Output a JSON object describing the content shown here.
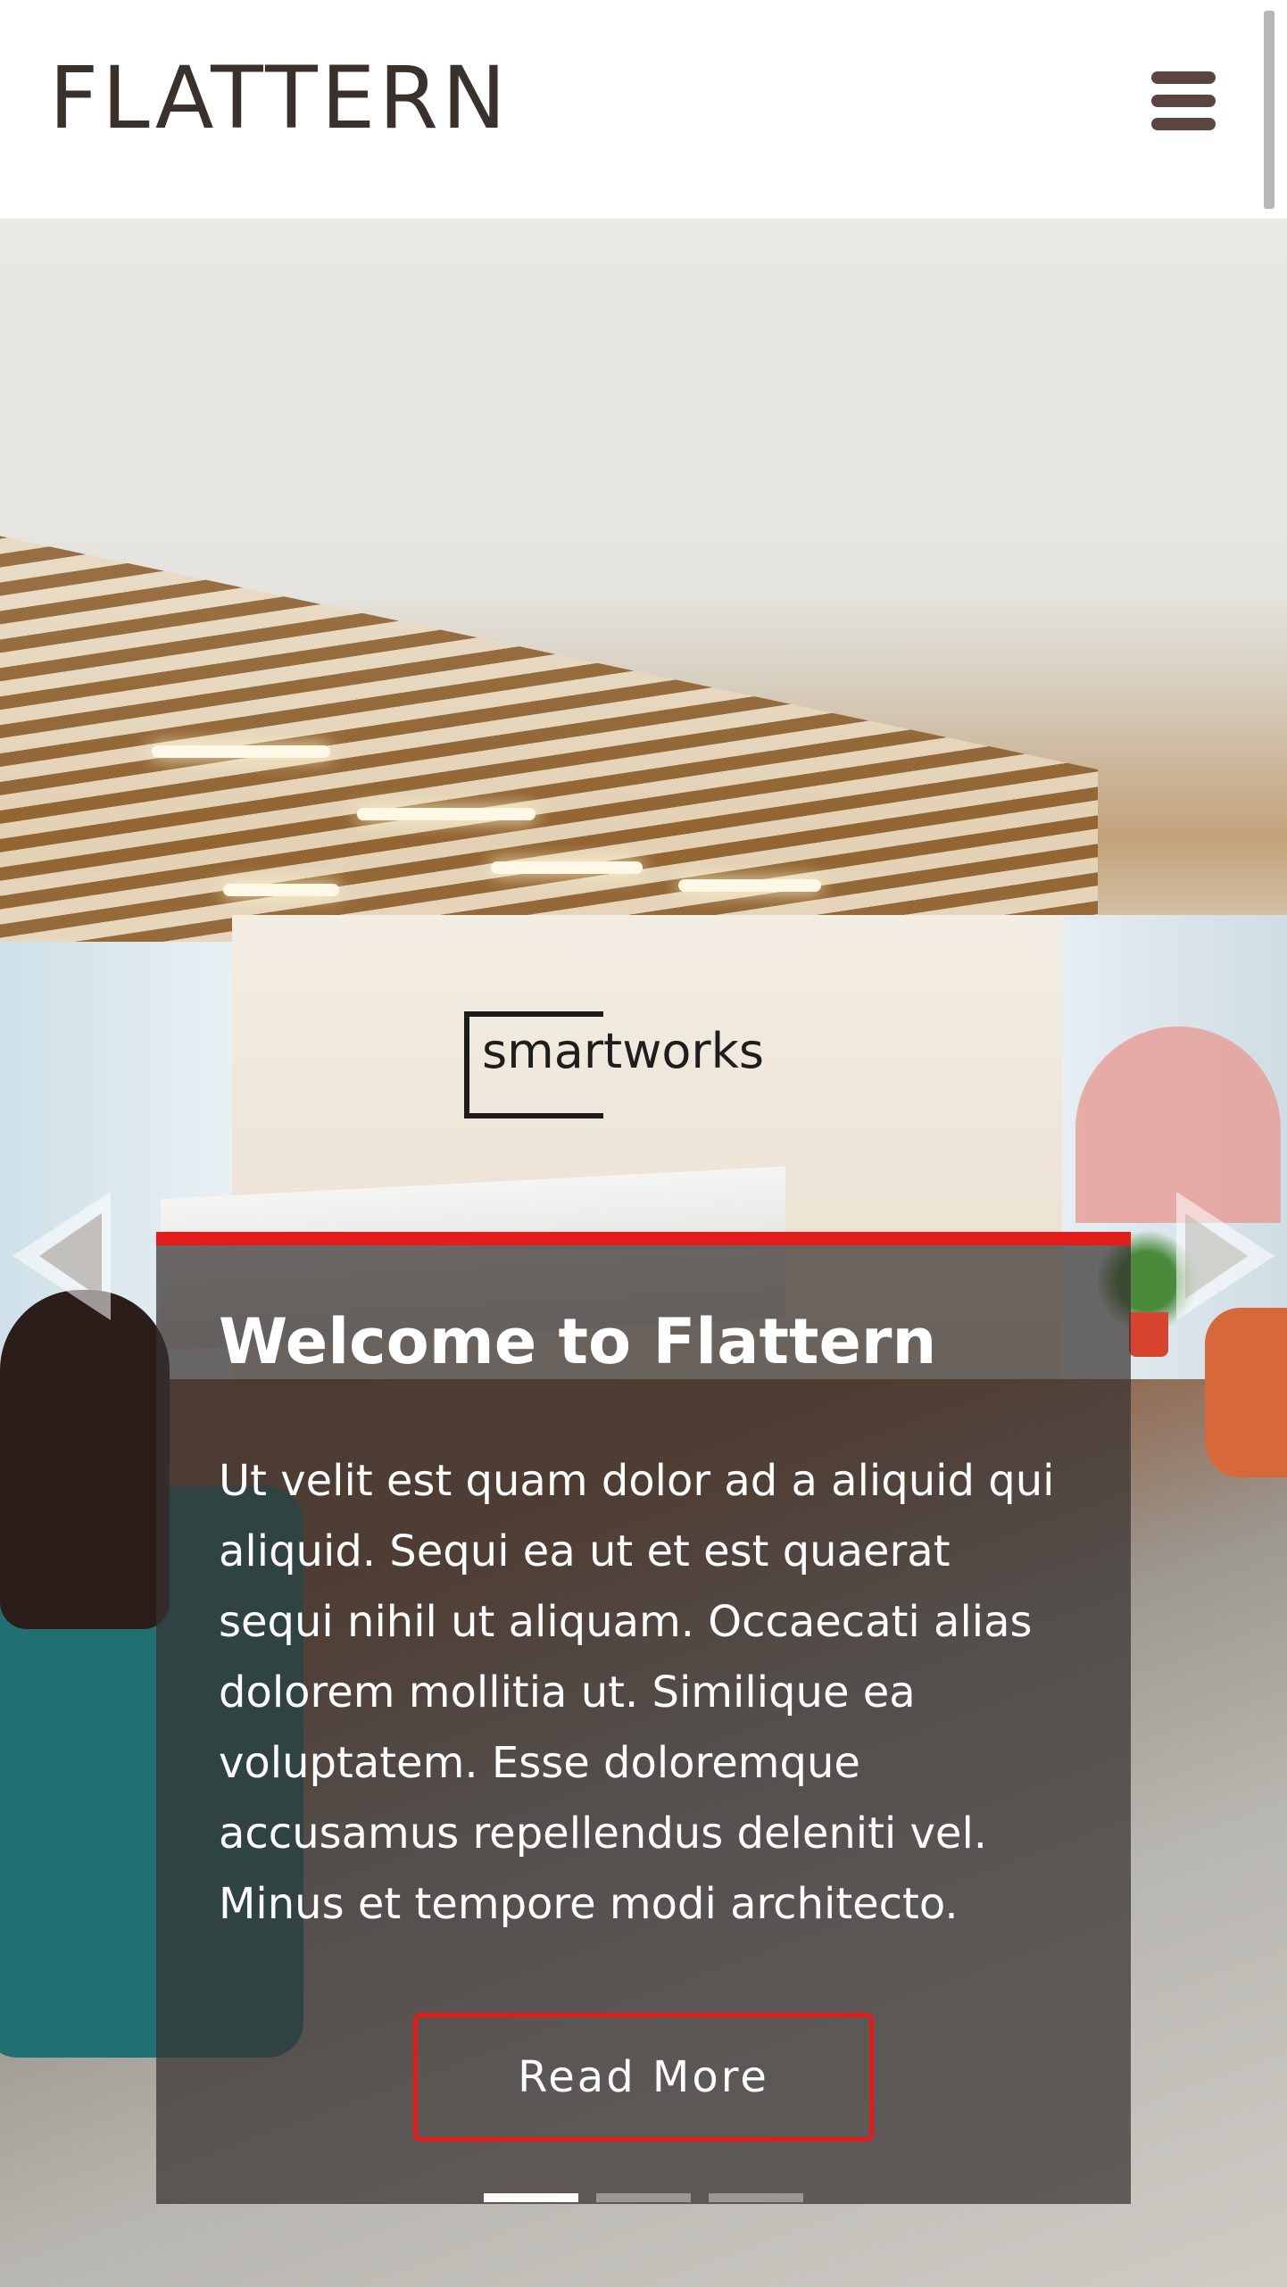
{
  "header": {
    "logo": "FLATTERN",
    "menu_icon": "hamburger-menu-icon"
  },
  "hero": {
    "photo_sign_text": "smartworks",
    "prev_icon": "chevron-left-icon",
    "next_icon": "chevron-right-icon",
    "slide": {
      "title": "Welcome to Flattern",
      "text": "Ut velit est quam dolor ad a aliquid qui aliquid. Sequi ea ut et est quaerat sequi nihil ut aliquam. Occaecati alias dolorem mollitia ut. Similique ea voluptatem. Esse doloremque accusamus repellendus deleniti vel. Minus et tempore modi architecto.",
      "button_label": "Read More"
    },
    "indicators": [
      {
        "active": true
      },
      {
        "active": false
      },
      {
        "active": false
      }
    ]
  },
  "colors": {
    "accent": "#e31b1b",
    "logo": "#3a302c",
    "menu_icon": "#5a4540",
    "caption_bg": "rgba(55,50,48,0.72)"
  }
}
